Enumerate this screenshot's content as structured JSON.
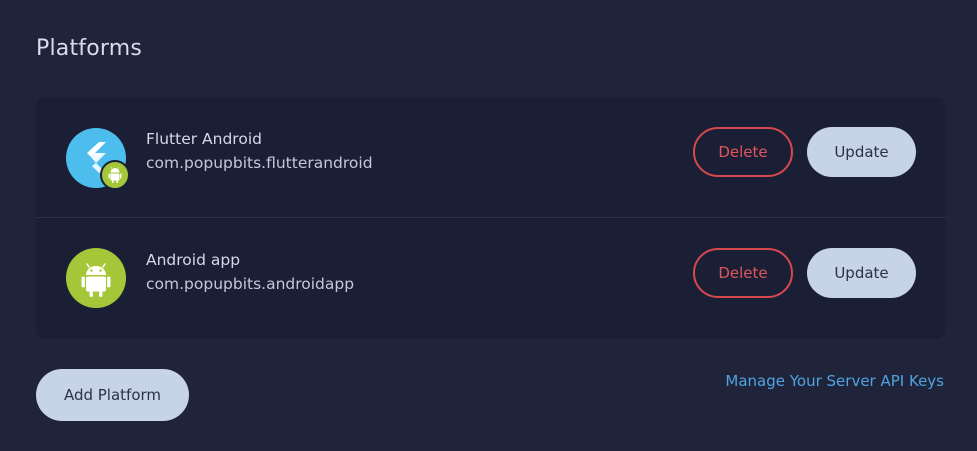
{
  "page": {
    "title": "Platforms"
  },
  "platforms": [
    {
      "name": "Flutter Android",
      "package_id": "com.popupbits.flutterandroid",
      "icon": "flutter-icon",
      "badge_icon": "android-icon",
      "delete_label": "Delete",
      "update_label": "Update"
    },
    {
      "name": "Android app",
      "package_id": "com.popupbits.androidapp",
      "icon": "android-icon",
      "delete_label": "Delete",
      "update_label": "Update"
    }
  ],
  "actions": {
    "add_platform_label": "Add Platform",
    "manage_keys_label": "Manage Your Server API Keys"
  },
  "colors": {
    "background": "#1f243a",
    "card": "#1b1f35",
    "delete": "#d6484e",
    "button": "#c6d3e8",
    "link": "#4ea3e0",
    "flutter": "#4dbdee",
    "android": "#a4c639"
  }
}
